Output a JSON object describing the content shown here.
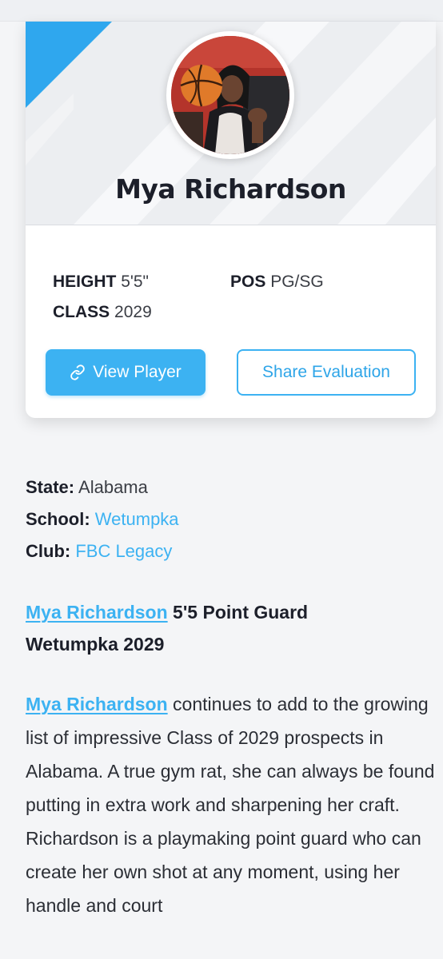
{
  "player": {
    "name": "Mya Richardson",
    "height_label": "HEIGHT",
    "height_value": "5'5\"",
    "pos_label": "POS",
    "pos_value": "PG/SG",
    "class_label": "CLASS",
    "class_value": "2029"
  },
  "buttons": {
    "view_player": "View Player",
    "share_evaluation": "Share Evaluation"
  },
  "details": {
    "state_label": "State:",
    "state_value": "Alabama",
    "school_label": "School:",
    "school_value": "Wetumpka",
    "club_label": "Club:",
    "club_value": "FBC Legacy"
  },
  "headline": {
    "name_link": "Mya Richardson",
    "line1_rest": " 5'5 Point Guard",
    "line2": "Wetumpka 2029"
  },
  "article": {
    "name_link": "Mya Richardson",
    "body": " continues to add to the growing list of impressive Class of 2029 prospects in Alabama. A true gym rat, she can always be found putting in extra work and sharpening her craft. Richardson is a playmaking point guard who can create her own shot at any moment, using her handle and court"
  },
  "colors": {
    "accent": "#3cb2f2",
    "text_dark": "#1c1f2a",
    "card_bg": "#ffffff",
    "page_bg": "#f4f5f7"
  },
  "icons": {
    "view_player_icon": "link-icon"
  }
}
